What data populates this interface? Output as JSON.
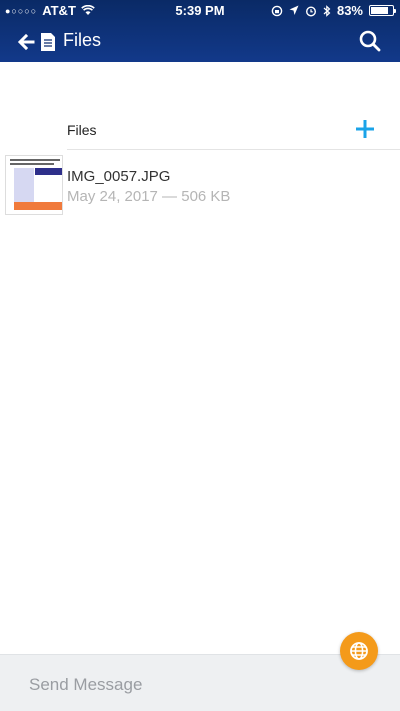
{
  "status_bar": {
    "carrier": "AT&T",
    "time": "5:39 PM",
    "battery": "83%",
    "battery_level": 0.83
  },
  "nav": {
    "title": "Files",
    "back_icon": "arrow-left-icon",
    "doc_icon": "document-icon",
    "search_icon": "search-icon"
  },
  "section": {
    "title": "Files",
    "add_icon": "plus-icon"
  },
  "files": [
    {
      "name": "IMG_0057.JPG",
      "meta": "May 24, 2017 — 506 KB"
    }
  ],
  "fab": {
    "icon": "globe-icon",
    "color": "#f49a1a"
  },
  "message": {
    "placeholder": "Send Message",
    "value": ""
  },
  "colors": {
    "header": "#0a2a66",
    "accent": "#1aa3e8"
  }
}
